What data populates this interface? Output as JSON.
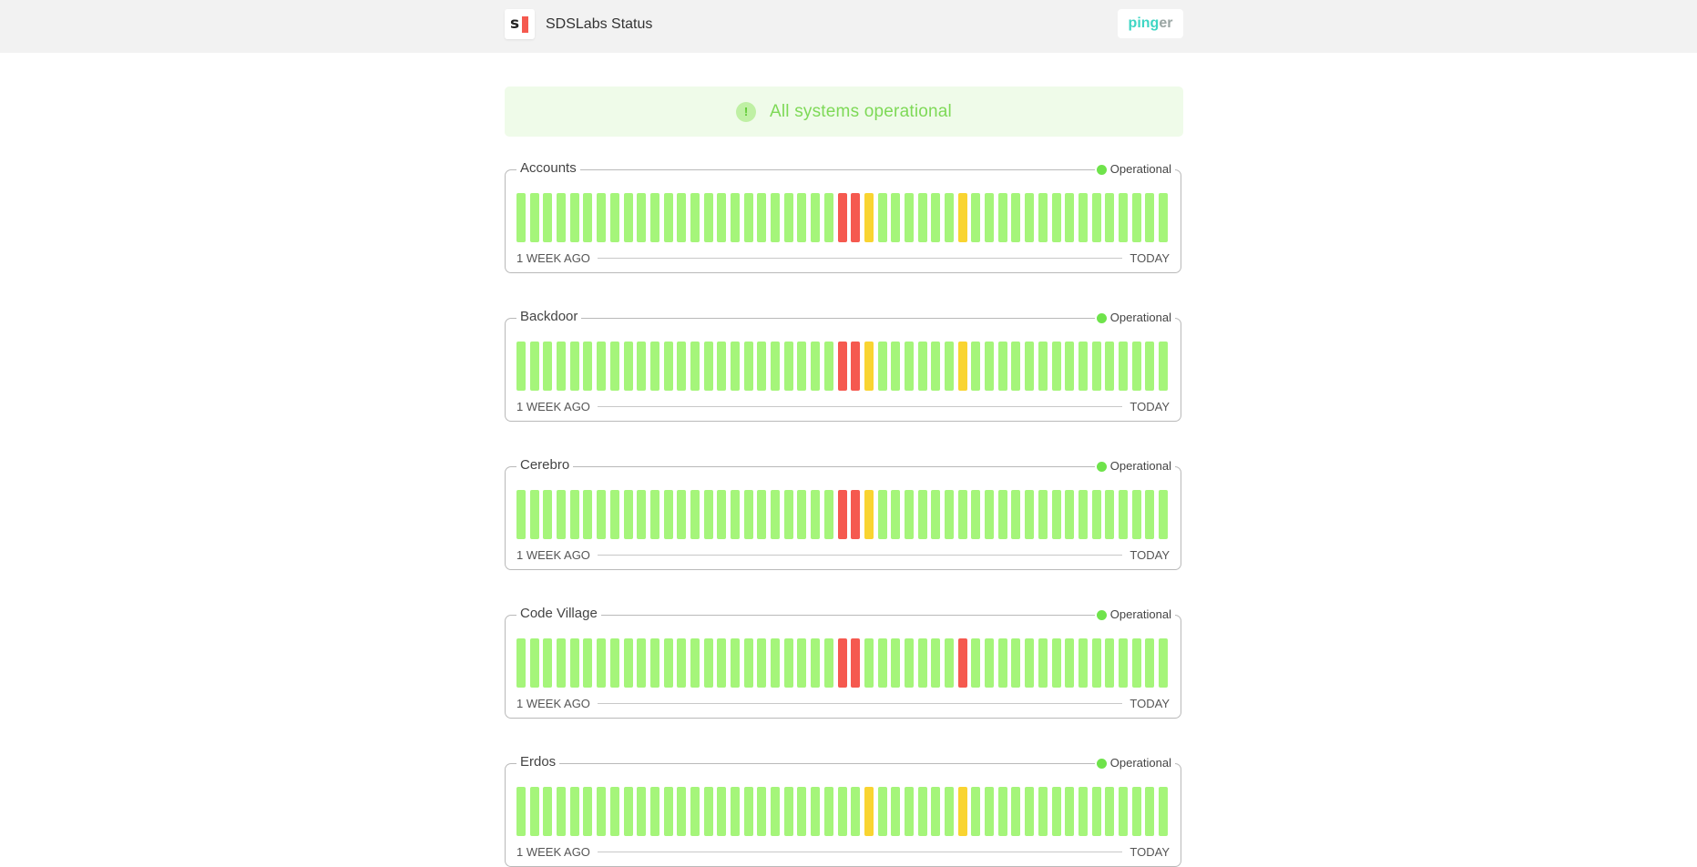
{
  "header": {
    "logo_letter": "s",
    "title": "SDSLabs Status",
    "pinger_left": "ping",
    "pinger_right": "er"
  },
  "banner": {
    "icon": "!",
    "text": "All systems operational"
  },
  "colors": {
    "up": "#a5f57a",
    "down": "#f5594f",
    "partial": "#f9d431",
    "operational_dot": "#6fe34b"
  },
  "labels": {
    "start": "1 WEEK AGO",
    "end": "TODAY"
  },
  "services": [
    {
      "name": "Accounts",
      "status": "Operational",
      "bars": [
        "up",
        "up",
        "up",
        "up",
        "up",
        "up",
        "up",
        "up",
        "up",
        "up",
        "up",
        "up",
        "up",
        "up",
        "up",
        "up",
        "up",
        "up",
        "up",
        "up",
        "up",
        "up",
        "up",
        "up",
        "down",
        "down",
        "partial",
        "up",
        "up",
        "up",
        "up",
        "up",
        "up",
        "partial",
        "up",
        "up",
        "up",
        "up",
        "up",
        "up",
        "up",
        "up",
        "up",
        "up",
        "up",
        "up",
        "up",
        "up",
        "up"
      ]
    },
    {
      "name": "Backdoor",
      "status": "Operational",
      "bars": [
        "up",
        "up",
        "up",
        "up",
        "up",
        "up",
        "up",
        "up",
        "up",
        "up",
        "up",
        "up",
        "up",
        "up",
        "up",
        "up",
        "up",
        "up",
        "up",
        "up",
        "up",
        "up",
        "up",
        "up",
        "down",
        "down",
        "partial",
        "up",
        "up",
        "up",
        "up",
        "up",
        "up",
        "partial",
        "up",
        "up",
        "up",
        "up",
        "up",
        "up",
        "up",
        "up",
        "up",
        "up",
        "up",
        "up",
        "up",
        "up",
        "up"
      ]
    },
    {
      "name": "Cerebro",
      "status": "Operational",
      "bars": [
        "up",
        "up",
        "up",
        "up",
        "up",
        "up",
        "up",
        "up",
        "up",
        "up",
        "up",
        "up",
        "up",
        "up",
        "up",
        "up",
        "up",
        "up",
        "up",
        "up",
        "up",
        "up",
        "up",
        "up",
        "down",
        "down",
        "partial",
        "up",
        "up",
        "up",
        "up",
        "up",
        "up",
        "up",
        "up",
        "up",
        "up",
        "up",
        "up",
        "up",
        "up",
        "up",
        "up",
        "up",
        "up",
        "up",
        "up",
        "up",
        "up"
      ]
    },
    {
      "name": "Code Village",
      "status": "Operational",
      "bars": [
        "up",
        "up",
        "up",
        "up",
        "up",
        "up",
        "up",
        "up",
        "up",
        "up",
        "up",
        "up",
        "up",
        "up",
        "up",
        "up",
        "up",
        "up",
        "up",
        "up",
        "up",
        "up",
        "up",
        "up",
        "down",
        "down",
        "up",
        "up",
        "up",
        "up",
        "up",
        "up",
        "up",
        "down",
        "up",
        "up",
        "up",
        "up",
        "up",
        "up",
        "up",
        "up",
        "up",
        "up",
        "up",
        "up",
        "up",
        "up",
        "up"
      ]
    },
    {
      "name": "Erdos",
      "status": "Operational",
      "bars": [
        "up",
        "up",
        "up",
        "up",
        "up",
        "up",
        "up",
        "up",
        "up",
        "up",
        "up",
        "up",
        "up",
        "up",
        "up",
        "up",
        "up",
        "up",
        "up",
        "up",
        "up",
        "up",
        "up",
        "up",
        "up",
        "up",
        "partial",
        "up",
        "up",
        "up",
        "up",
        "up",
        "up",
        "partial",
        "up",
        "up",
        "up",
        "up",
        "up",
        "up",
        "up",
        "up",
        "up",
        "up",
        "up",
        "up",
        "up",
        "up",
        "up"
      ]
    }
  ]
}
